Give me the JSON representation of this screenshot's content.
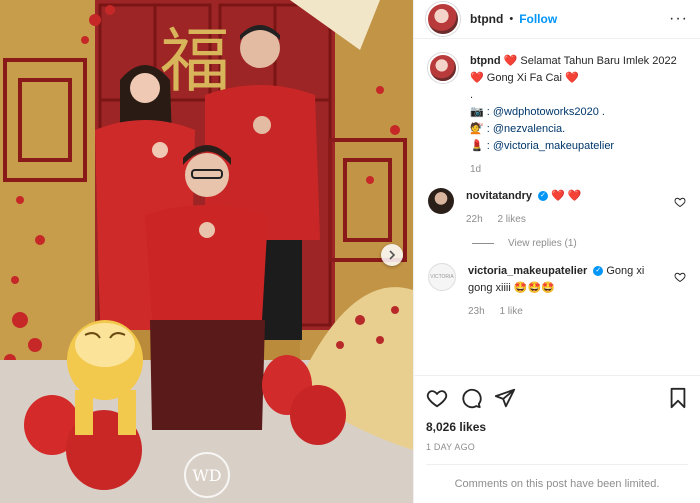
{
  "header": {
    "username": "btpnd",
    "dot": "•",
    "follow_label": "Follow",
    "more_label": "···"
  },
  "caption": {
    "username": "btpnd",
    "line1": "Selamat Tahun Baru Imlek 2022",
    "line2": "Gong Xi Fa Cai",
    "period": ".",
    "credit1": ": @wdphotoworks2020 .",
    "credit2": ": @nezvalencia.",
    "credit3": ": @victoria_makeupatelier",
    "age": "1d",
    "emoji_heart": "❤️",
    "emoji_camera": "📷",
    "emoji_hair": "💇",
    "emoji_makeup": "💄"
  },
  "comments": [
    {
      "username": "novitatandry",
      "text": "❤️ ❤️",
      "age": "22h",
      "likes": "2 likes",
      "view_replies": "View replies (1)"
    },
    {
      "username": "victoria_makeupatelier",
      "text": "Gong xi gong xiiii 🤩🤩🤩",
      "age": "23h",
      "likes": "1 like",
      "avatar_text": "VICTORIA"
    }
  ],
  "post": {
    "likes": "8,026 likes",
    "time": "1 DAY AGO",
    "comments_limited": "Comments on this post have been limited."
  },
  "photo": {
    "banner_char": "福",
    "watermark": "WD"
  },
  "colors": {
    "accent": "#0095f6",
    "heart": "#e0245e",
    "muted": "#8e8e8e"
  }
}
